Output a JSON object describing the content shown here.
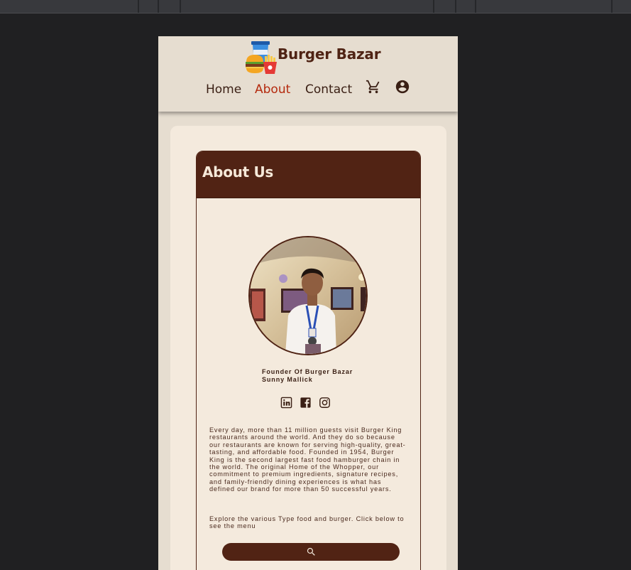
{
  "brand": {
    "name": "Burger Bazar"
  },
  "nav": {
    "items": [
      {
        "label": "Home",
        "active": false
      },
      {
        "label": "About",
        "active": true
      },
      {
        "label": "Contact",
        "active": false
      }
    ],
    "icons": [
      "cart-icon",
      "account-icon"
    ]
  },
  "about": {
    "title": "About Us",
    "founder_role": "Founder Of Burger Bazar",
    "founder_name": "Sunny Mallick",
    "social_icons": [
      "linkedin-icon",
      "facebook-icon",
      "instagram-icon"
    ],
    "paragraph": "Every day, more than 11 million guests visit Burger King restaurants around the world. And they do so because our restaurants are known for serving high-quality, great-tasting, and affordable food. Founded in 1954, Burger King is the second largest fast food hamburger chain in the world. The original Home of the Whopper, our commitment to premium ingredients, signature recipes, and family-friendly dining experiences is what has defined our brand for more than 50 successful years.",
    "explore_text": "Explore the various Type food and burger. Click below to see the menu",
    "button_icon": "search-icon"
  },
  "colors": {
    "accent": "#512314",
    "active_link": "#b4290d",
    "header_bg": "#e6ddd0",
    "card_bg": "#f4eadd"
  }
}
